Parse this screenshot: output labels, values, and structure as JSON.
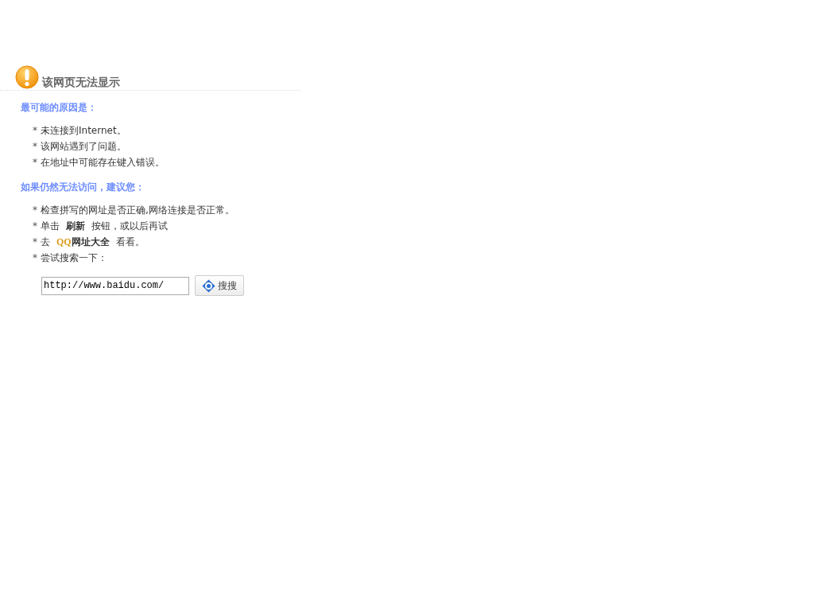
{
  "title": "该网页无法显示",
  "reasons": {
    "heading": "最可能的原因是：",
    "items": [
      {
        "bullet": "*",
        "text": "未连接到Internet。"
      },
      {
        "bullet": "*",
        "text": "该网站遇到了问题。"
      },
      {
        "bullet": "*",
        "text": "在地址中可能存在键入错误。"
      }
    ]
  },
  "suggestions": {
    "heading": "如果仍然无法访问，建议您：",
    "items": [
      {
        "kind": "text",
        "bullet": "*",
        "text": "检查拼写的网址是否正确,网络连接是否正常。"
      },
      {
        "kind": "action",
        "bullet": "*",
        "before": "单击",
        "action": "刷新",
        "after": "按钮，或以后再试"
      },
      {
        "kind": "link",
        "bullet": "*",
        "before": "去",
        "brand": "QQ",
        "link": "网址大全",
        "after": "看看。"
      },
      {
        "kind": "text",
        "bullet": "*",
        "text": "尝试搜索一下："
      }
    ]
  },
  "search": {
    "value": "http://www.baidu.com/",
    "button": "搜搜"
  }
}
